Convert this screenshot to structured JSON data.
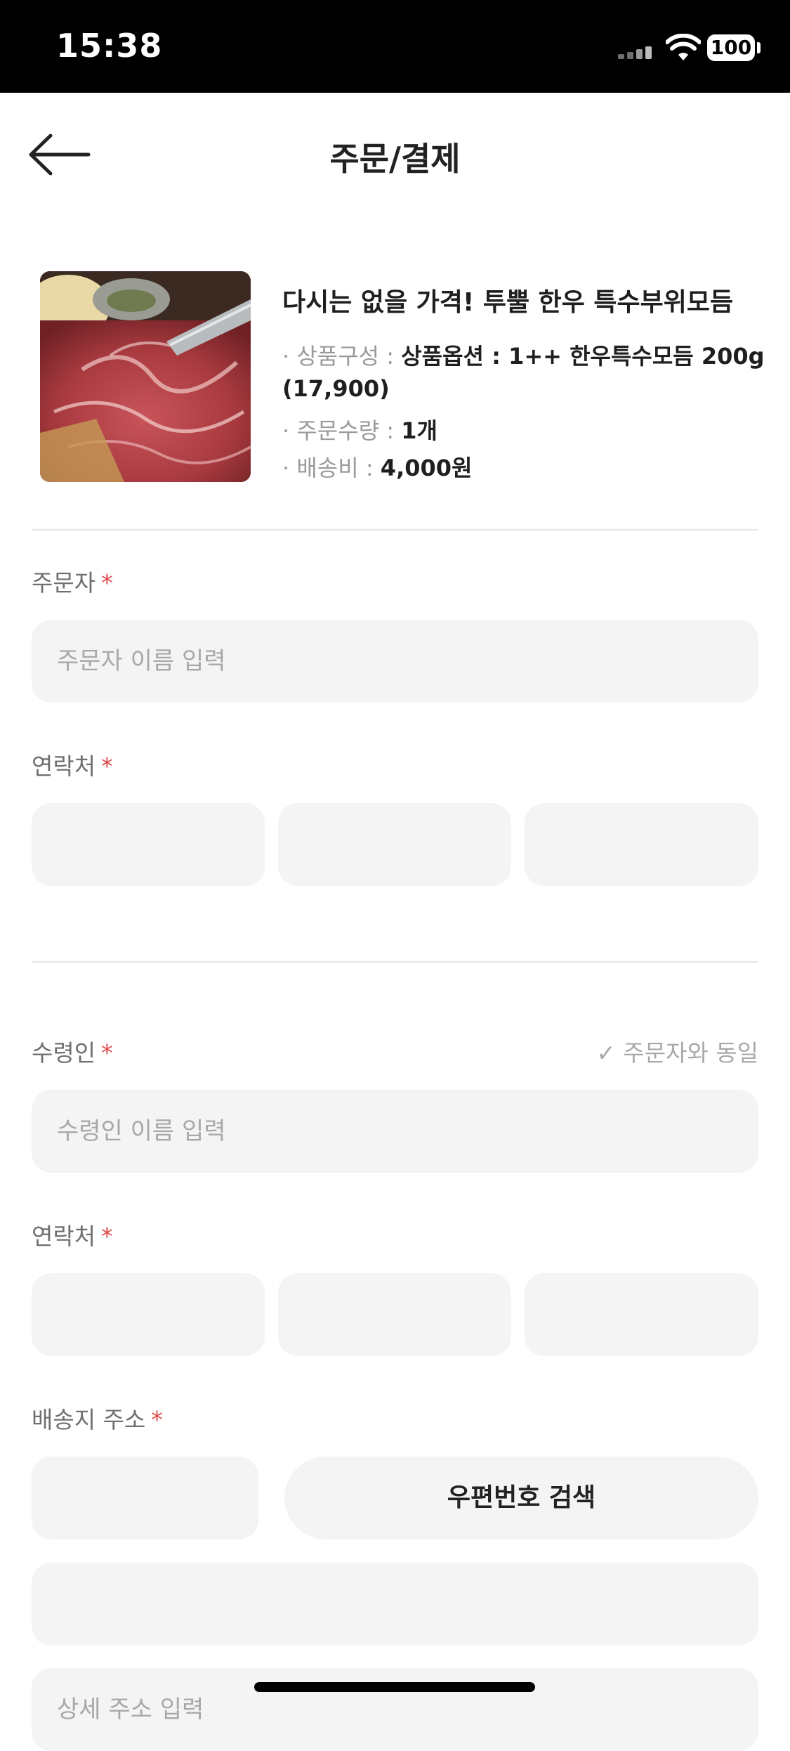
{
  "status_bar": {
    "time": "15:38",
    "battery": "100"
  },
  "header": {
    "title": "주문/결제"
  },
  "product": {
    "title": "다시는 없을 가격! 투뿔 한우 특수부위모듬",
    "option_label": "· 상품구성 : ",
    "option_value": "상품옵션 : 1++ 한우특수모듬 200g",
    "option_price": "(17,900)",
    "qty_label": "· 주문수량 : ",
    "qty_value": "1개",
    "shipping_label": "· 배송비 : ",
    "shipping_value": "4,000원"
  },
  "orderer": {
    "label": "주문자",
    "required_mark": "*",
    "name_placeholder": "주문자 이름 입력",
    "contact_label": "연락처"
  },
  "recipient": {
    "label": "수령인",
    "same_as_orderer": "✓ 주문자와 동일",
    "name_placeholder": "수령인 이름 입력",
    "contact_label": "연락처",
    "address_label": "배송지 주소",
    "zip_search_button": "우편번호 검색",
    "detail_address_placeholder": "상세 주소 입력"
  },
  "colors": {
    "required": "#e24a4a",
    "field_background": "#f4f4f4",
    "status_bar": "#000000"
  },
  "icons": {
    "back": "arrow-left-icon",
    "wifi": "wifi-icon",
    "signal": "cellular-signal-icon",
    "battery": "battery-icon"
  }
}
